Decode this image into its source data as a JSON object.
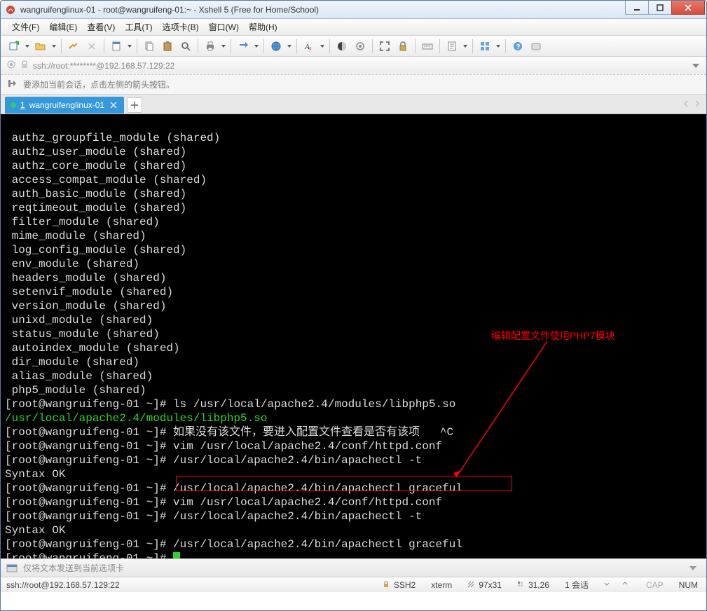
{
  "title": "wangruifenglinux-01 - root@wangruifeng-01:~ - Xshell 5 (Free for Home/School)",
  "menu": {
    "file": "文件(F)",
    "edit": "编辑(E)",
    "view": "查看(V)",
    "tools": "工具(T)",
    "tabs": "选项卡(B)",
    "window": "窗口(W)",
    "help": "帮助(H)"
  },
  "address": {
    "text": "ssh://root:********@192.168.57.129:22"
  },
  "hint": {
    "text": "要添加当前会话，点击左侧的箭头按钮。"
  },
  "tab": {
    "index": "1",
    "label": "wangruifenglinux-01"
  },
  "terminal": {
    "lines": [
      " authz_groupfile_module (shared)",
      " authz_user_module (shared)",
      " authz_core_module (shared)",
      " access_compat_module (shared)",
      " auth_basic_module (shared)",
      " reqtimeout_module (shared)",
      " filter_module (shared)",
      " mime_module (shared)",
      " log_config_module (shared)",
      " env_module (shared)",
      " headers_module (shared)",
      " setenvif_module (shared)",
      " version_module (shared)",
      " unixd_module (shared)",
      " status_module (shared)",
      " autoindex_module (shared)",
      " dir_module (shared)",
      " alias_module (shared)",
      " php5_module (shared)"
    ],
    "prompt_ls": "[root@wangruifeng-01 ~]# ls /usr/local/apache2.4/modules/libphp5.so",
    "green_path": "/usr/local/apache2.4/modules/libphp5.so",
    "prompt_cn": "[root@wangruifeng-01 ~]# 如果没有该文件，要进入配置文件查看是否有该项   ^C",
    "prompt_vim1": "[root@wangruifeng-01 ~]# vim /usr/local/apache2.4/conf/httpd.conf",
    "prompt_test1": "[root@wangruifeng-01 ~]# /usr/local/apache2.4/bin/apachectl -t",
    "syntax_ok1": "Syntax OK",
    "prompt_graceful1": "[root@wangruifeng-01 ~]# /usr/local/apache2.4/bin/apachectl graceful",
    "prompt_vim2_prefix": "[root@wangruifeng-01 ~]# ",
    "prompt_vim2_cmd": "vim /usr/local/apache2.4/conf/httpd.conf",
    "prompt_test2": "[root@wangruifeng-01 ~]# /usr/local/apache2.4/bin/apachectl -t",
    "syntax_ok2": "Syntax OK",
    "prompt_graceful2": "[root@wangruifeng-01 ~]# /usr/local/apache2.4/bin/apachectl graceful",
    "prompt_last": "[root@wangruifeng-01 ~]# "
  },
  "annotation": {
    "text": "编辑配置文件使用PHP7模块"
  },
  "input_hint": "仅将文本发送到当前选项卡",
  "status": {
    "left": "ssh://root@192.168.57.129:22",
    "ssh": "SSH2",
    "term": "xterm",
    "size": "97x31",
    "pos": "31,26",
    "sessions": "1 会话",
    "cap": "CAP",
    "num": "NUM"
  }
}
